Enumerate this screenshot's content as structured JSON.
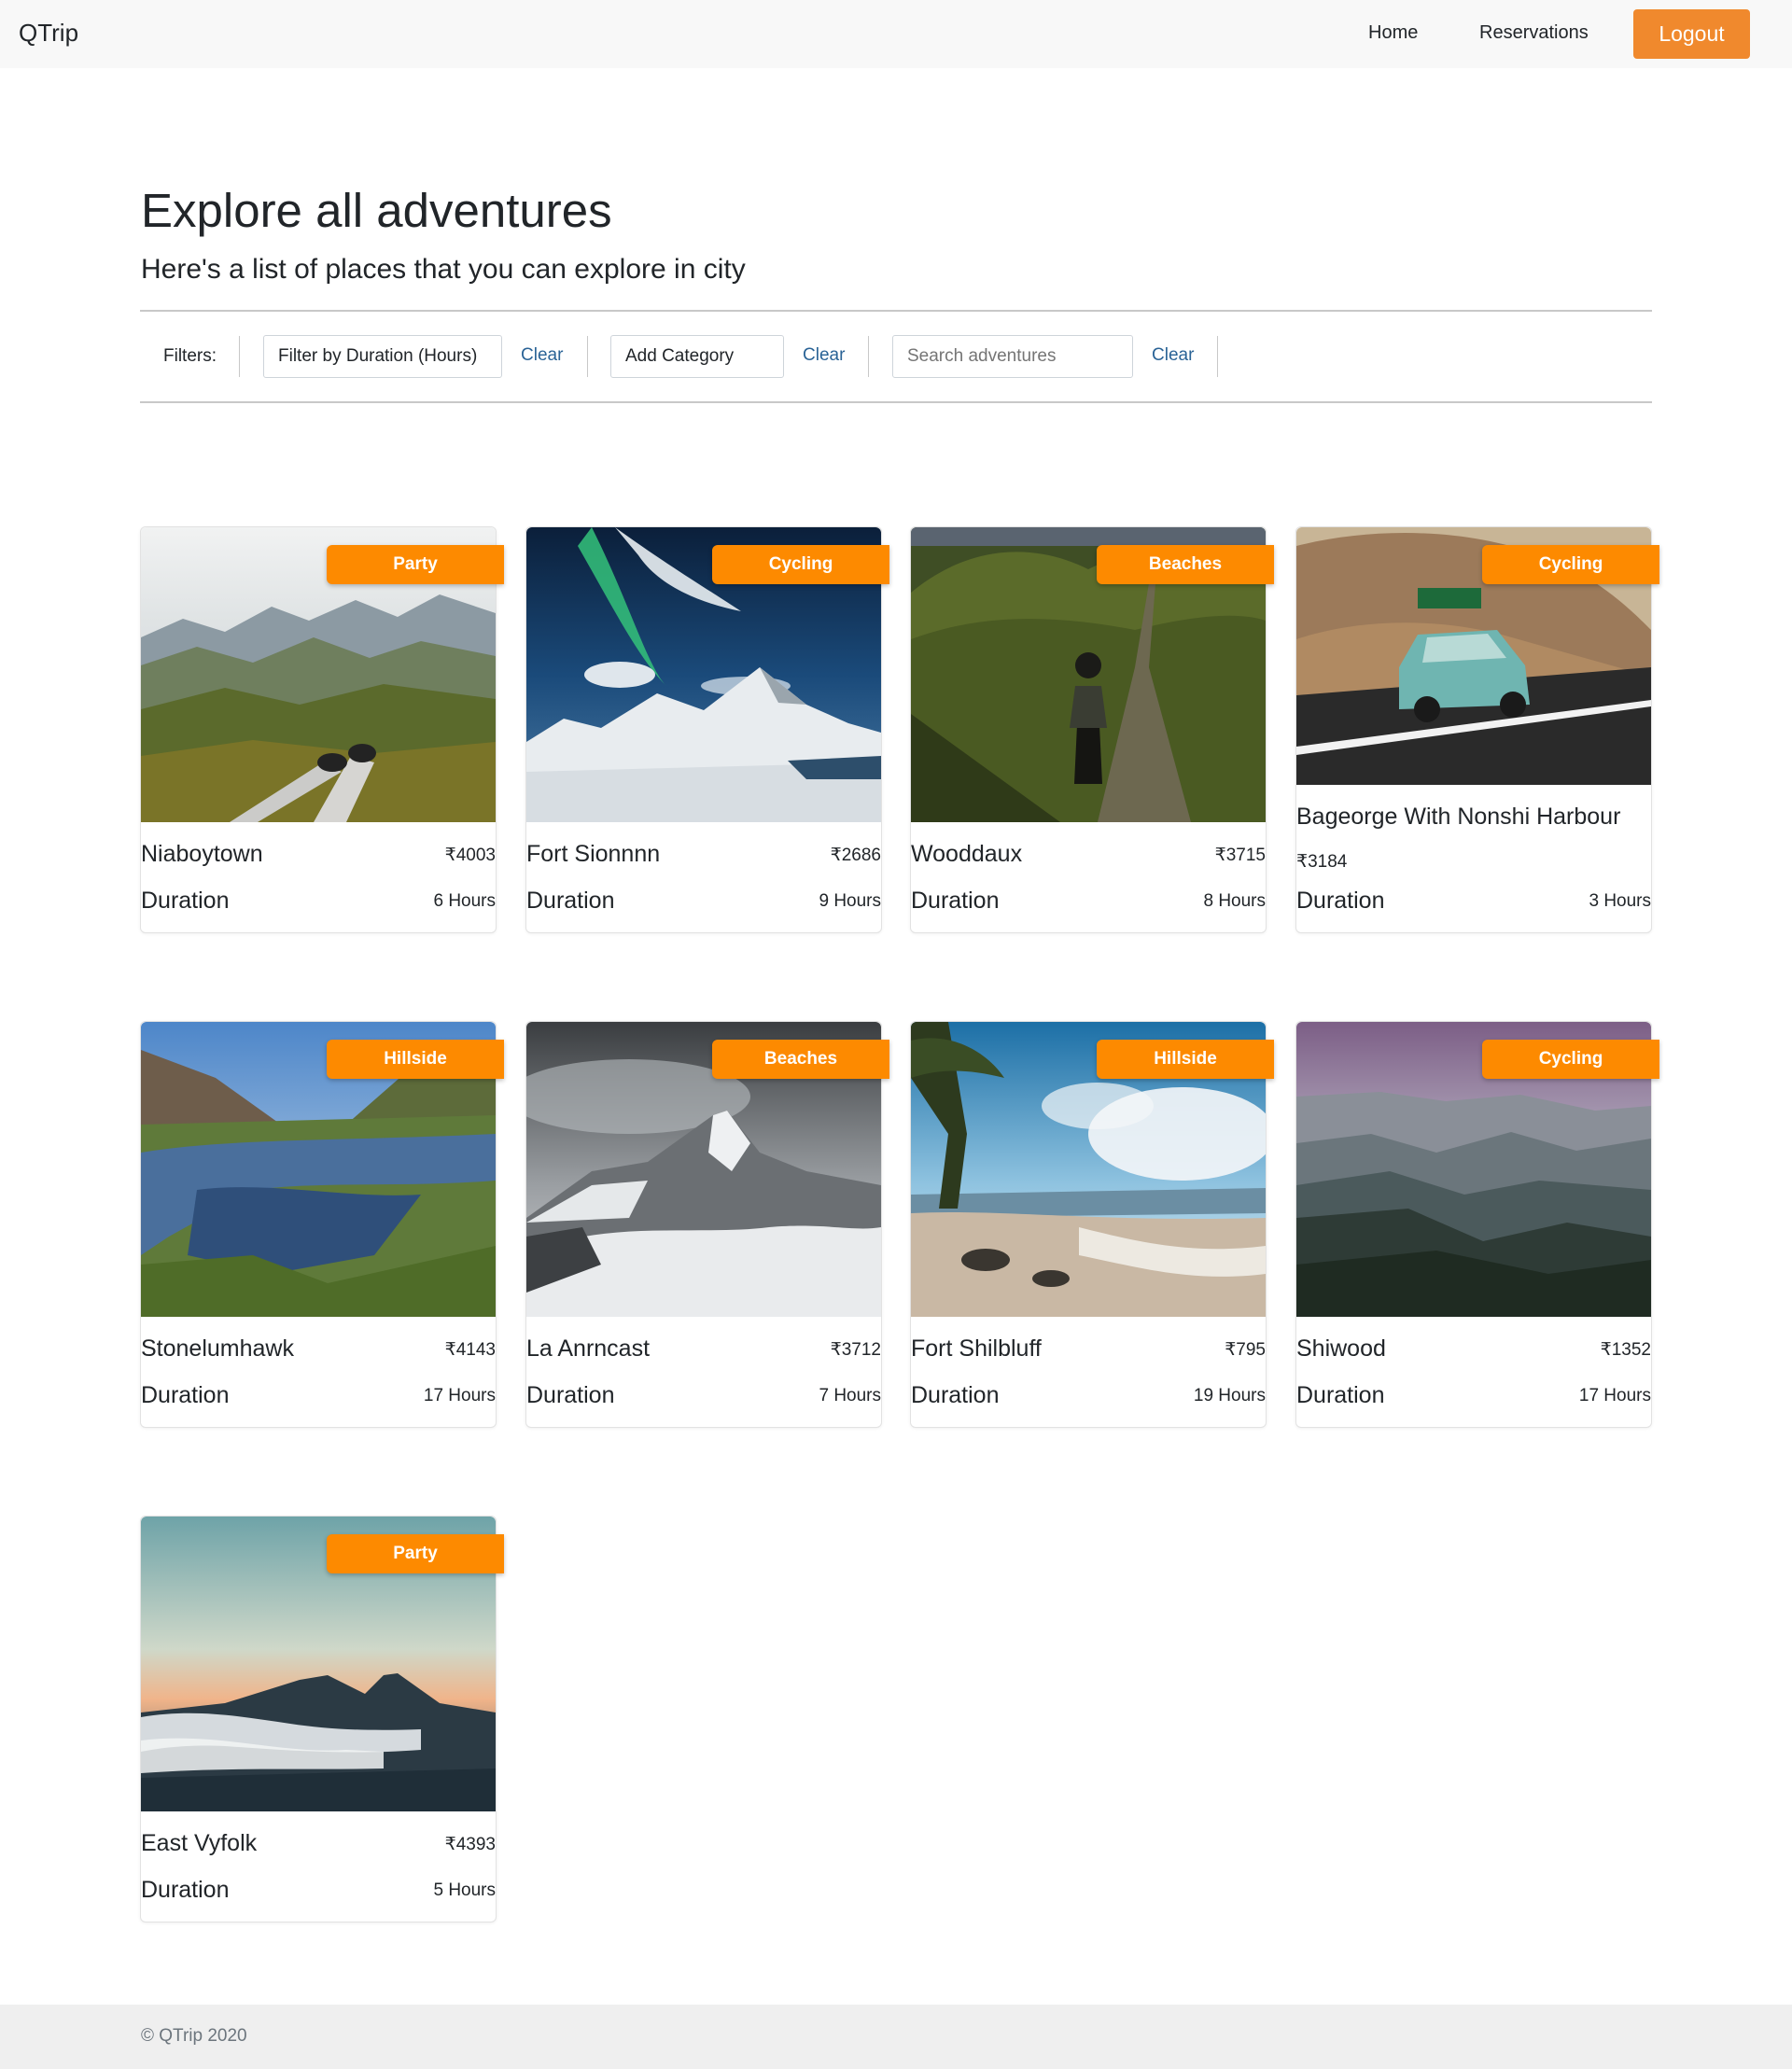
{
  "nav": {
    "brand": "QTrip",
    "home": "Home",
    "reservations": "Reservations",
    "logout": "Logout"
  },
  "header": {
    "title": "Explore all adventures",
    "subtitle": "Here's a list of places that you can explore in city"
  },
  "filters": {
    "label": "Filters:",
    "duration_select": "Filter by Duration (Hours)",
    "category_select": "Add Category",
    "search_placeholder": "Search adventures",
    "search_value": "",
    "clear_label": "Clear"
  },
  "colors": {
    "accent": "#f0892d",
    "badge": "#fd8a00",
    "link": "#2a6396"
  },
  "adventures": [
    {
      "name": "Niaboytown",
      "category": "Party",
      "price": "₹4003",
      "duration_label": "Duration",
      "duration": "6 Hours",
      "image": "mountain-valley-feet-photo"
    },
    {
      "name": "Fort Sionnnn",
      "category": "Cycling",
      "price": "₹2686",
      "duration_label": "Duration",
      "duration": "9 Hours",
      "image": "aurora-snowy-mountain-photo"
    },
    {
      "name": "Wooddaux",
      "category": "Beaches",
      "price": "₹3715",
      "duration_label": "Duration",
      "duration": "8 Hours",
      "image": "hiker-on-trail-photo"
    },
    {
      "name": "Bageorge With Nonshi Harbour",
      "category": "Cycling",
      "price": "₹3184",
      "duration_label": "Duration",
      "duration": "3 Hours",
      "image": "vintage-car-desert-road-photo"
    },
    {
      "name": "Stonelumhawk",
      "category": "Hillside",
      "price": "₹4143",
      "duration_label": "Duration",
      "duration": "17 Hours",
      "image": "river-valley-photo"
    },
    {
      "name": "La Anrncast",
      "category": "Beaches",
      "price": "₹3712",
      "duration_label": "Duration",
      "duration": "7 Hours",
      "image": "cloudy-mountain-peak-photo"
    },
    {
      "name": "Fort Shilbluff",
      "category": "Hillside",
      "price": "₹795",
      "duration_label": "Duration",
      "duration": "19 Hours",
      "image": "tropical-beach-photo"
    },
    {
      "name": "Shiwood",
      "category": "Cycling",
      "price": "₹1352",
      "duration_label": "Duration",
      "duration": "17 Hours",
      "image": "misty-mountain-range-photo"
    },
    {
      "name": "East Vyfolk",
      "category": "Party",
      "price": "₹4393",
      "duration_label": "Duration",
      "duration": "5 Hours",
      "image": "volcano-above-clouds-photo"
    }
  ],
  "footer": {
    "copyright": "© QTrip 2020"
  }
}
